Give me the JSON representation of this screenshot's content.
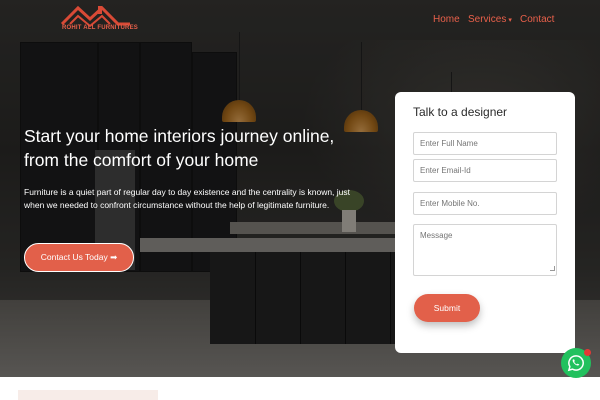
{
  "brand": {
    "logo_text": "ROHIT ALL FURNITURES",
    "accent": "#e2604a"
  },
  "nav": {
    "home": "Home",
    "services": "Services",
    "services_caret": "▾",
    "contact": "Contact"
  },
  "hero": {
    "headline_line1": "Start your home interiors journey online,",
    "headline_line2": "from the comfort of your home",
    "description": "Furniture is a quiet part of regular day to day existence and the centrality is known, just when we needed to confront circumstance without the help of legitimate furniture.",
    "cta_label": "Contact Us Today ➡"
  },
  "form": {
    "title": "Talk to a designer",
    "full_name_placeholder": "Enter Full Name",
    "email_placeholder": "Enter Email-Id",
    "mobile_placeholder": "Enter Mobile No.",
    "message_placeholder": "Message",
    "submit_label": "Submit"
  },
  "floating": {
    "whatsapp_icon": "whatsapp-icon",
    "whatsapp_color": "#22c15e"
  }
}
